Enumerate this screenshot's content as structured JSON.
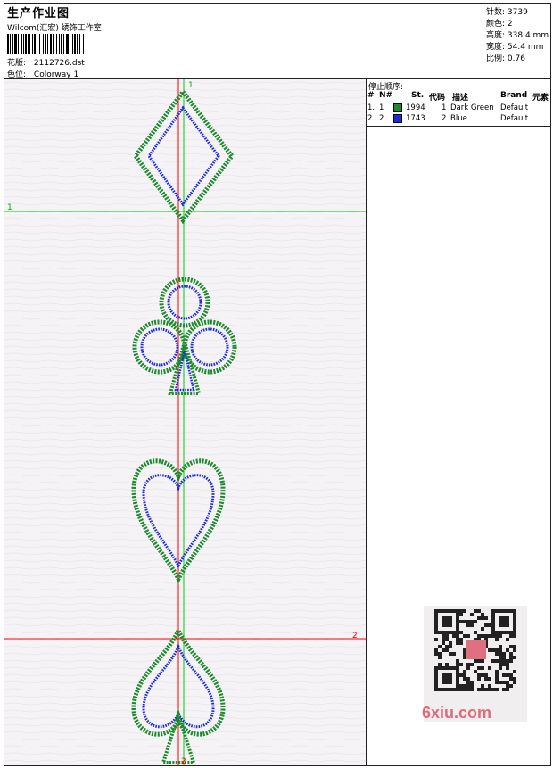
{
  "header": {
    "title": "生产作业图",
    "company": "Wilcom(汇宏) 绣饰工作室",
    "design_label": "花版:",
    "design_file": "2112726.dst",
    "colorway_label": "色位:",
    "colorway": "Colorway 1"
  },
  "stats": {
    "stitches_label": "针数:",
    "stitches": "3739",
    "colors_label": "颜色:",
    "colors": "2",
    "height_label": "高度:",
    "height": "338.4 mm",
    "width_label": "宽度:",
    "width": "54.4 mm",
    "scale_label": "比例:",
    "scale": "0.76"
  },
  "stop_sequence": {
    "label": "停止顺序:",
    "columns": [
      "#",
      "N#",
      "St.",
      "代码",
      "描述",
      "Brand",
      "元素"
    ],
    "rows": [
      {
        "idx": "1.",
        "n": "1",
        "swatch": "#1a8a2a",
        "stitches": "1994",
        "code": "1",
        "desc": "Dark Green",
        "brand": "Default"
      },
      {
        "idx": "2.",
        "n": "2",
        "swatch": "#1a2adc",
        "stitches": "1743",
        "code": "2",
        "desc": "Blue",
        "brand": "Default"
      }
    ]
  },
  "markers": {
    "top": "1",
    "left": "1",
    "right": "2",
    "bottom": "2"
  },
  "watermark": "6xiu.com",
  "colors": {
    "green": "#1a8a2a",
    "blue": "#1a2adc",
    "red_guide": "#ff0000",
    "green_guide": "#00cc00"
  }
}
